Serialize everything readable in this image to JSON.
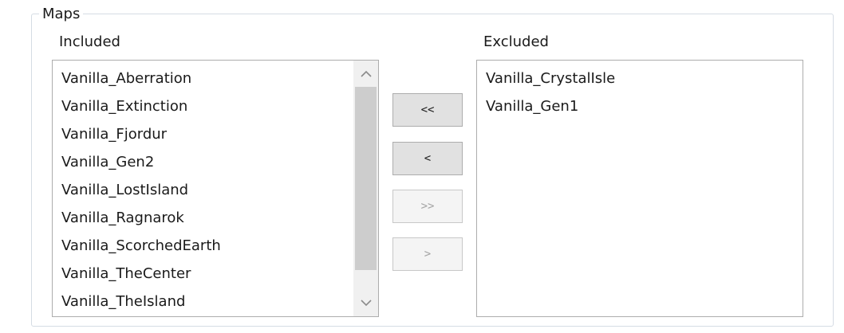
{
  "group": {
    "title": "Maps"
  },
  "included": {
    "label": "Included",
    "items": [
      "Vanilla_Aberration",
      "Vanilla_Extinction",
      "Vanilla_Fjordur",
      "Vanilla_Gen2",
      "Vanilla_LostIsland",
      "Vanilla_Ragnarok",
      "Vanilla_ScorchedEarth",
      "Vanilla_TheCenter",
      "Vanilla_TheIsland"
    ]
  },
  "excluded": {
    "label": "Excluded",
    "items": [
      "Vanilla_CrystalIsle",
      "Vanilla_Gen1"
    ]
  },
  "buttons": {
    "include_all": "<<",
    "include_selected": "<",
    "exclude_all": ">>",
    "exclude_selected": ">"
  },
  "colors": {
    "border": "#adadad",
    "button_face": "#e1e1e1",
    "scroll_thumb": "#cdcdcd"
  }
}
